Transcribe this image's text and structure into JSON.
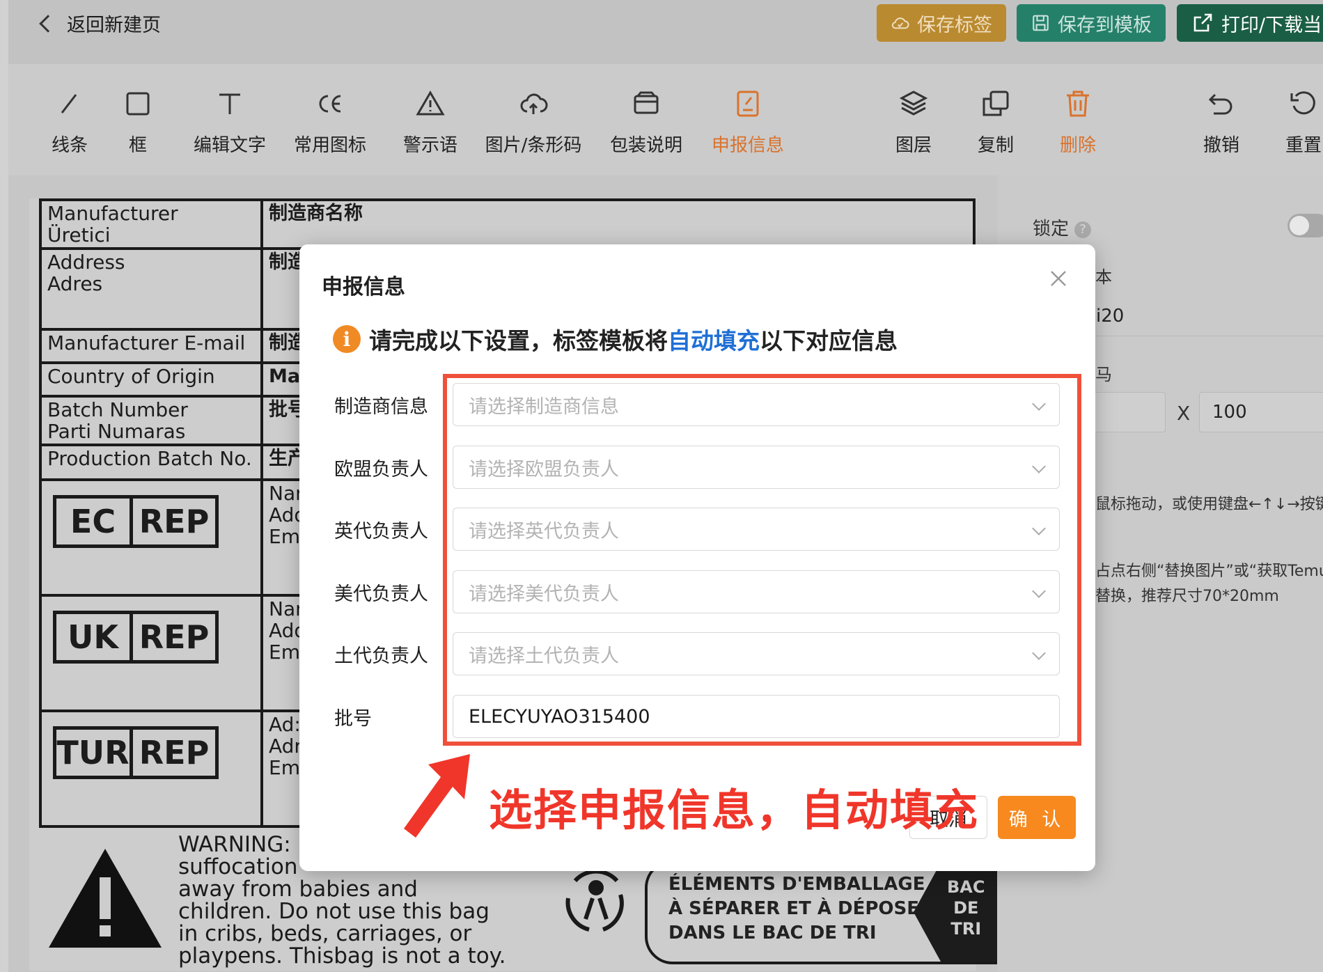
{
  "header": {
    "back_label": "返回新建页",
    "save_tag_label": "保存标签",
    "save_template_label": "保存到模板",
    "print_label": "打印/下载当"
  },
  "toolbar": {
    "tools": [
      {
        "label": "线条",
        "icon": "line-icon"
      },
      {
        "label": "框",
        "icon": "rectangle-icon"
      },
      {
        "label": "编辑文字",
        "icon": "text-icon"
      },
      {
        "label": "常用图标",
        "icon": "ce-mark-icon"
      },
      {
        "label": "警示语",
        "icon": "warning-icon"
      },
      {
        "label": "图片/条形码",
        "icon": "cloud-upload-icon"
      },
      {
        "label": "包装说明",
        "icon": "package-icon"
      },
      {
        "label": "申报信息",
        "icon": "declaration-icon",
        "active": true
      },
      {
        "label": "图层",
        "icon": "layers-icon"
      },
      {
        "label": "复制",
        "icon": "copy-icon"
      },
      {
        "label": "删除",
        "icon": "trash-icon",
        "active": true
      },
      {
        "label": "撤销",
        "icon": "undo-icon"
      },
      {
        "label": "重置",
        "icon": "reset-icon"
      }
    ]
  },
  "label_preview": {
    "rows": [
      {
        "left": "Manufacturer\nÜretici",
        "right": "制造商名称"
      },
      {
        "left": "Address\nAdres",
        "right": "制造"
      },
      {
        "left": "Manufacturer E-mail",
        "right": "制造"
      },
      {
        "left": "Country of Origin",
        "right": "Ma"
      },
      {
        "left": "Batch Number\nParti Numaras",
        "right": "批号"
      },
      {
        "left": "Production Batch No.",
        "right": "生产"
      }
    ],
    "rep_blocks": [
      {
        "left": "EC",
        "right": "REP",
        "details": "Nar\nAdd\nEm"
      },
      {
        "left": "UK",
        "right": "REP",
        "details": "Nar\nAdd\nEm"
      },
      {
        "left": "TUR",
        "right": "REP",
        "details": "Ad:\nAdr\nEm"
      }
    ],
    "warning_text": "WARNING:\nsuffocation\naway from babies and\nchildren. Do not use this bag\nin cribs, beds, carriages, or\nplaypens. Thisbag is not a toy.",
    "bac_text": "ÉLÉMENTS D'EMBALLAGE\nÀ SÉPARER ET À DÉPOSER\nDANS LE BAC DE TRI",
    "bac_badge": "BAC\nDE\nTRI"
  },
  "right_panel": {
    "lock_label": "锁定",
    "help_glyph": "?",
    "font_label_fragment": "本",
    "font_value_fragment": "ei20",
    "size_label_fragment": "马",
    "size_separator": "X",
    "size_height": "100",
    "hint1": "鼠标拖动，或使用键盘←↑↓→按键",
    "hint2": "占点右侧“替换图片”或“获取Temu",
    "hint3": "替换，推荐尺寸70*20mm"
  },
  "modal": {
    "title": "申报信息",
    "notice_prefix": "请完成以下设置，标签模板将",
    "notice_highlight": "自动填充",
    "notice_suffix": "以下对应信息",
    "fields": [
      {
        "label": "制造商信息",
        "placeholder": "请选择制造商信息",
        "value": ""
      },
      {
        "label": "欧盟负责人",
        "placeholder": "请选择欧盟负责人",
        "value": ""
      },
      {
        "label": "英代负责人",
        "placeholder": "请选择英代负责人",
        "value": ""
      },
      {
        "label": "美代负责人",
        "placeholder": "请选择美代负责人",
        "value": ""
      },
      {
        "label": "土代负责人",
        "placeholder": "请选择土代负责人",
        "value": ""
      },
      {
        "label": "批号",
        "placeholder": "",
        "value": "ELECYUYAO315400"
      }
    ],
    "cancel_label": "取消",
    "confirm_label": "确 认"
  },
  "annotation": {
    "text": "选择申报信息，自动填充"
  },
  "colors": {
    "accent_orange": "#f7891f",
    "highlight_blue": "#1f6fd6",
    "annotation_red": "#f0362a"
  }
}
